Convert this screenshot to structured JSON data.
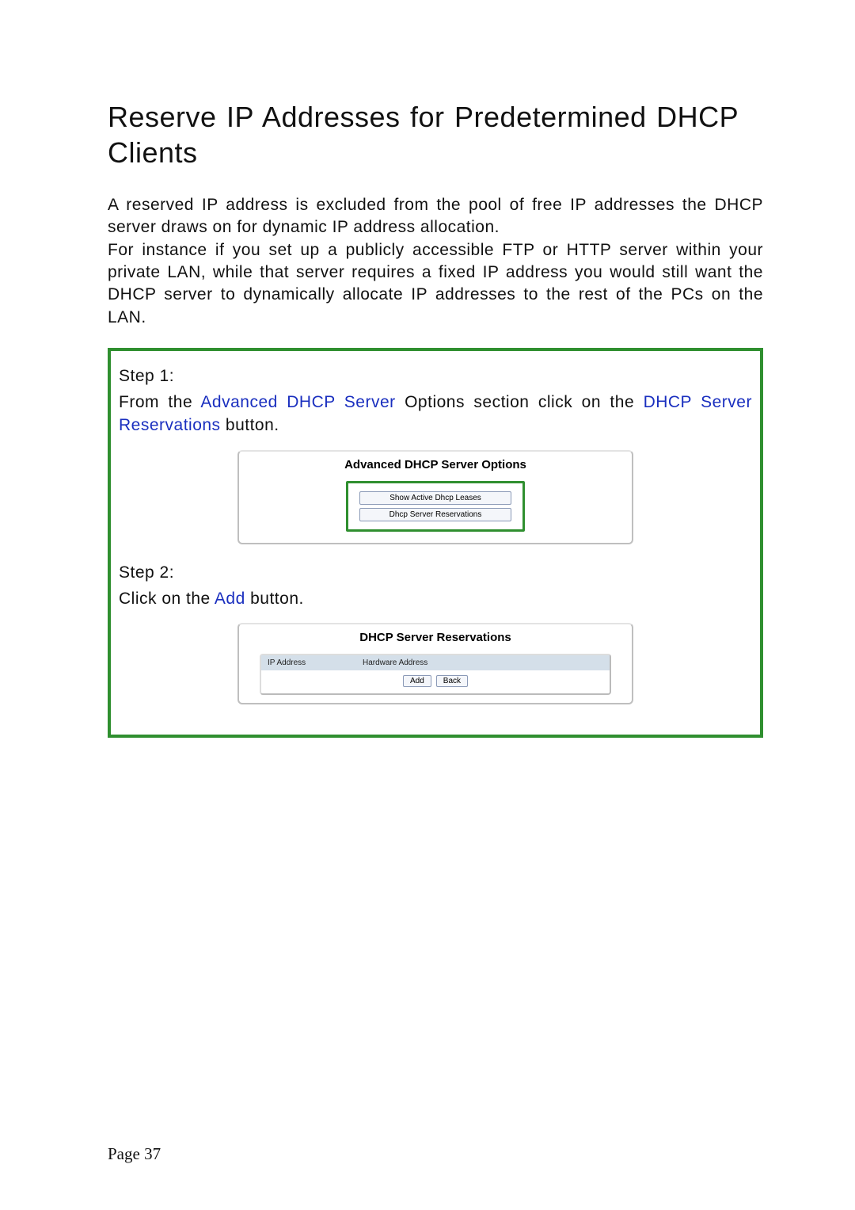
{
  "title": "Reserve IP Addresses for Predetermined DHCP Clients",
  "body": "A reserved IP address is excluded from the pool of free IP addresses the DHCP server draws on for dynamic IP address allocation.\nFor instance if you set up a publicly accessible FTP or HTTP server within your private LAN, while that server requires a fixed IP address you would still want the DHCP server to dynamically allocate IP addresses to the rest of the PCs on the LAN.",
  "steps": {
    "step1": {
      "label": "Step 1:",
      "prefix": "From the ",
      "link1": "Advanced DHCP Server",
      "mid": " Options section click on the ",
      "link2": "DHCP Server Reservations",
      "suffix": " button."
    },
    "panel1": {
      "title": "Advanced DHCP Server Options",
      "btn1": "Show Active Dhcp Leases",
      "btn2": "Dhcp Server Reservations"
    },
    "step2": {
      "label": "Step 2:",
      "prefix": "Click on the ",
      "link1": "Add",
      "suffix": " button."
    },
    "panel2": {
      "title": "DHCP Server Reservations",
      "col_ip": "IP Address",
      "col_hw": "Hardware Address",
      "btn_add": "Add",
      "btn_back": "Back"
    }
  },
  "footer": "Page 37"
}
